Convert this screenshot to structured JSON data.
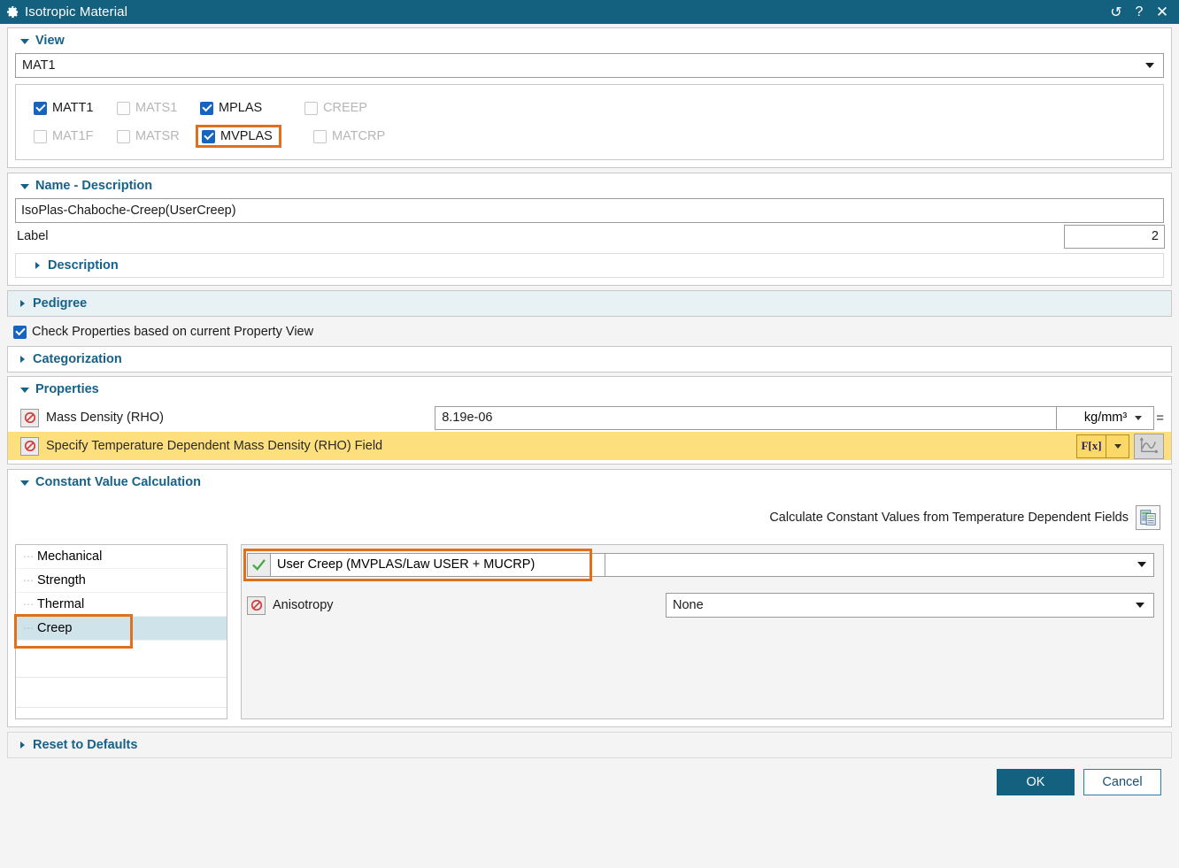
{
  "window": {
    "title": "Isotropic Material",
    "gear_icon": "gear-icon",
    "controls": [
      {
        "name": "reset-icon",
        "glyph": "↺"
      },
      {
        "name": "help-icon",
        "glyph": "?"
      },
      {
        "name": "close-icon",
        "glyph": "✕"
      }
    ]
  },
  "view_section": {
    "title": "View",
    "expanded": true,
    "selected_view": "MAT1",
    "flags_row1": [
      {
        "label": "MATT1",
        "checked": true,
        "enabled": true,
        "highlighted": false
      },
      {
        "label": "MATS1",
        "checked": false,
        "enabled": false,
        "highlighted": false
      },
      {
        "label": "MPLAS",
        "checked": true,
        "enabled": true,
        "highlighted": false
      },
      {
        "label": "CREEP",
        "checked": false,
        "enabled": false,
        "highlighted": false
      }
    ],
    "flags_row2": [
      {
        "label": "MAT1F",
        "checked": false,
        "enabled": false,
        "highlighted": false
      },
      {
        "label": "MATSR",
        "checked": false,
        "enabled": false,
        "highlighted": false
      },
      {
        "label": "MVPLAS",
        "checked": true,
        "enabled": true,
        "highlighted": true
      },
      {
        "label": "MATCRP",
        "checked": false,
        "enabled": false,
        "highlighted": false
      }
    ]
  },
  "name_section": {
    "title": "Name - Description",
    "name_value": "IsoPlas-Chaboche-Creep(UserCreep)",
    "label_caption": "Label",
    "label_value": "2",
    "description_title": "Description"
  },
  "pedigree": {
    "title": "Pedigree"
  },
  "check_properties": {
    "label": "Check Properties based on current Property View",
    "checked": true
  },
  "categorization": {
    "title": "Categorization"
  },
  "properties": {
    "title": "Properties",
    "rows": [
      {
        "icon": "blocked-icon",
        "label": "Mass Density (RHO)",
        "value": "8.19e-06",
        "unit": "kg/mm³",
        "equals_glyph": "=",
        "highlighted": false
      },
      {
        "icon": "blocked-icon",
        "label": "Specify Temperature Dependent Mass Density (RHO) Field",
        "fx_label": "F[x]",
        "curve_icon": "curve-chart-icon",
        "highlighted": true
      }
    ]
  },
  "constant_value_calculation": {
    "title": "Constant Value Calculation",
    "action_label": "Calculate Constant Values from Temperature Dependent Fields",
    "action_icon": "table-report-icon"
  },
  "tree": {
    "items": [
      {
        "label": "Mechanical",
        "selected": false,
        "highlighted": false
      },
      {
        "label": "Strength",
        "selected": false,
        "highlighted": false
      },
      {
        "label": "Thermal",
        "selected": false,
        "highlighted": false
      },
      {
        "label": "Creep",
        "selected": true,
        "highlighted": true
      }
    ]
  },
  "detail": {
    "user_creep": {
      "check_icon": "green-check-icon",
      "label": "User Creep (MVPLAS/Law USER + MUCRP)",
      "highlighted": true
    },
    "anisotropy": {
      "icon": "blocked-icon",
      "label": "Anisotropy",
      "value": "None"
    }
  },
  "reset_to_defaults": {
    "title": "Reset to Defaults"
  },
  "footer": {
    "ok_label": "OK",
    "cancel_label": "Cancel"
  },
  "colors": {
    "titlebar": "#14607f",
    "accent_link": "#16628a",
    "highlight_box": "#e0701b",
    "checkbox_checked": "#1565c0",
    "yellow_row": "#fddf7e",
    "tree_selected": "#cfe3ea",
    "primary_button": "#14607f"
  }
}
